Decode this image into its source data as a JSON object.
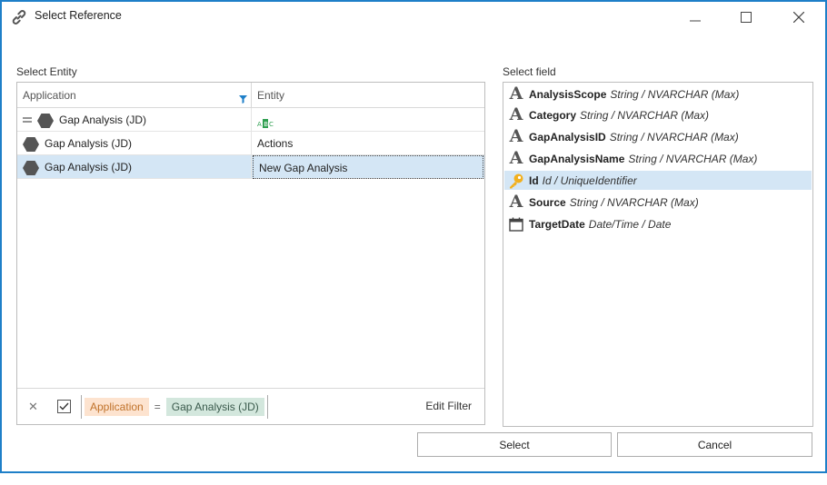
{
  "window": {
    "title": "Select Reference",
    "icon": "link-icon",
    "controls": [
      "minimize-icon",
      "maximize-icon",
      "close-icon"
    ]
  },
  "entity_panel": {
    "label": "Select Entity",
    "columns": {
      "application": "Application",
      "entity": "Entity"
    },
    "filter_row": {
      "operator_icon": "equals-icon",
      "application": "Gap Analysis (JD)",
      "entity_icon": "abc-text-icon"
    },
    "rows": [
      {
        "application": "Gap Analysis (JD)",
        "entity": "Actions"
      },
      {
        "application": "Gap Analysis (JD)",
        "entity": "New Gap Analysis",
        "selected": true
      }
    ],
    "filter_bar": {
      "field": "Application",
      "operator": "=",
      "value": "Gap Analysis (JD)",
      "enabled": true,
      "edit_label": "Edit Filter"
    }
  },
  "field_panel": {
    "label": "Select field",
    "fields": [
      {
        "name": "AnalysisScope",
        "type": "String / NVARCHAR (Max)",
        "icon": "string-icon"
      },
      {
        "name": "Category",
        "type": "String / NVARCHAR (Max)",
        "icon": "string-icon"
      },
      {
        "name": "GapAnalysisID",
        "type": "String / NVARCHAR (Max)",
        "icon": "string-icon"
      },
      {
        "name": "GapAnalysisName",
        "type": "String / NVARCHAR (Max)",
        "icon": "string-icon"
      },
      {
        "name": "Id",
        "type": "Id / UniqueIdentifier",
        "icon": "key-icon",
        "selected": true
      },
      {
        "name": "Source",
        "type": "String / NVARCHAR (Max)",
        "icon": "string-icon"
      },
      {
        "name": "TargetDate",
        "type": "Date/Time / Date",
        "icon": "calendar-icon"
      }
    ]
  },
  "buttons": {
    "select": "Select",
    "cancel": "Cancel"
  },
  "colors": {
    "accent": "#1e7fc8",
    "selection": "#d4e6f5",
    "key": "#f2b01e",
    "filter_field": "#fde3cf",
    "filter_value": "#d3e7dd"
  }
}
